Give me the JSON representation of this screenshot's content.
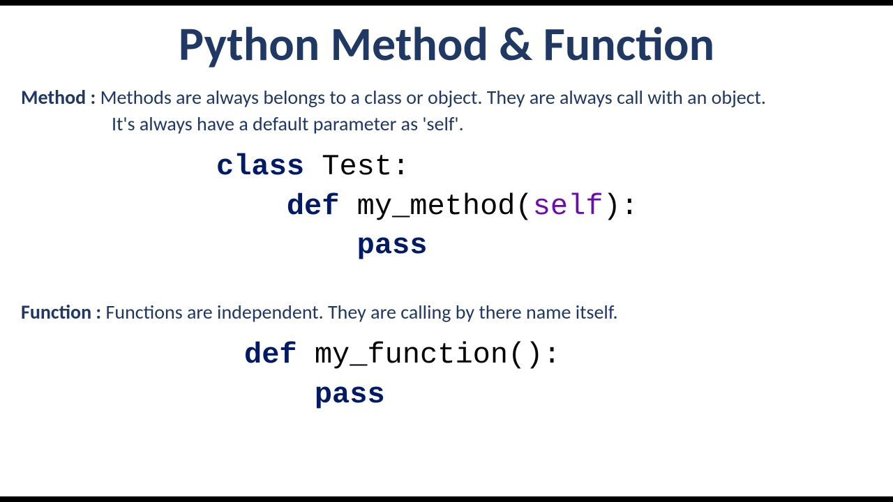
{
  "title": "Python Method & Function",
  "method": {
    "label": "Method :",
    "desc_line1": " Methods are always belongs to a class or object. They are always call with an object.",
    "desc_line2": "It's always have a default parameter as 'self'."
  },
  "function": {
    "label": "Function :",
    "desc": " Functions are independent. They are calling by there name itself."
  },
  "code": {
    "kw_class": "class",
    "class_name": " Test:",
    "kw_def1": "def",
    "method_sig_pre": " my_method(",
    "self_param": "self",
    "method_sig_post": "):",
    "kw_pass1": "pass",
    "kw_def2": "def",
    "func_sig": " my_function():",
    "kw_pass2": "pass"
  }
}
